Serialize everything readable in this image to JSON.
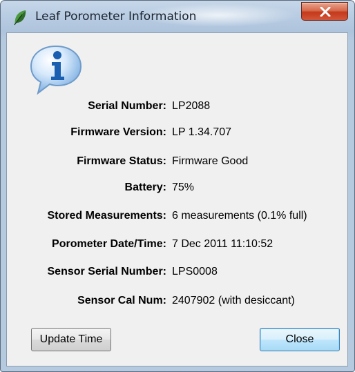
{
  "window": {
    "title": "Leaf Porometer Information",
    "app_icon": "leaf-icon",
    "close_icon": "close-icon"
  },
  "content": {
    "icon": "information-icon",
    "fields": [
      {
        "label": "Serial Number:",
        "value": "LP2088"
      },
      {
        "label": "Firmware Version:",
        "value": "LP 1.34.707"
      },
      {
        "label": "Firmware Status:",
        "value": "Firmware Good"
      },
      {
        "label": "Battery:",
        "value": "75%"
      },
      {
        "label": "Stored Measurements:",
        "value": "6 measurements (0.1% full)"
      },
      {
        "label": "Porometer Date/Time:",
        "value": "7 Dec 2011 11:10:52"
      },
      {
        "label": "Sensor Serial Number:",
        "value": "LPS0008"
      },
      {
        "label": "Sensor Cal Num:",
        "value": "2407902 (with desiccant)"
      }
    ]
  },
  "buttons": {
    "update_time": "Update Time",
    "close": "Close"
  },
  "colors": {
    "title_bar": "#b9cde3",
    "close_button": "#c5391b",
    "client_background": "#f0f0f0",
    "default_button_border": "#3c7fb1"
  }
}
